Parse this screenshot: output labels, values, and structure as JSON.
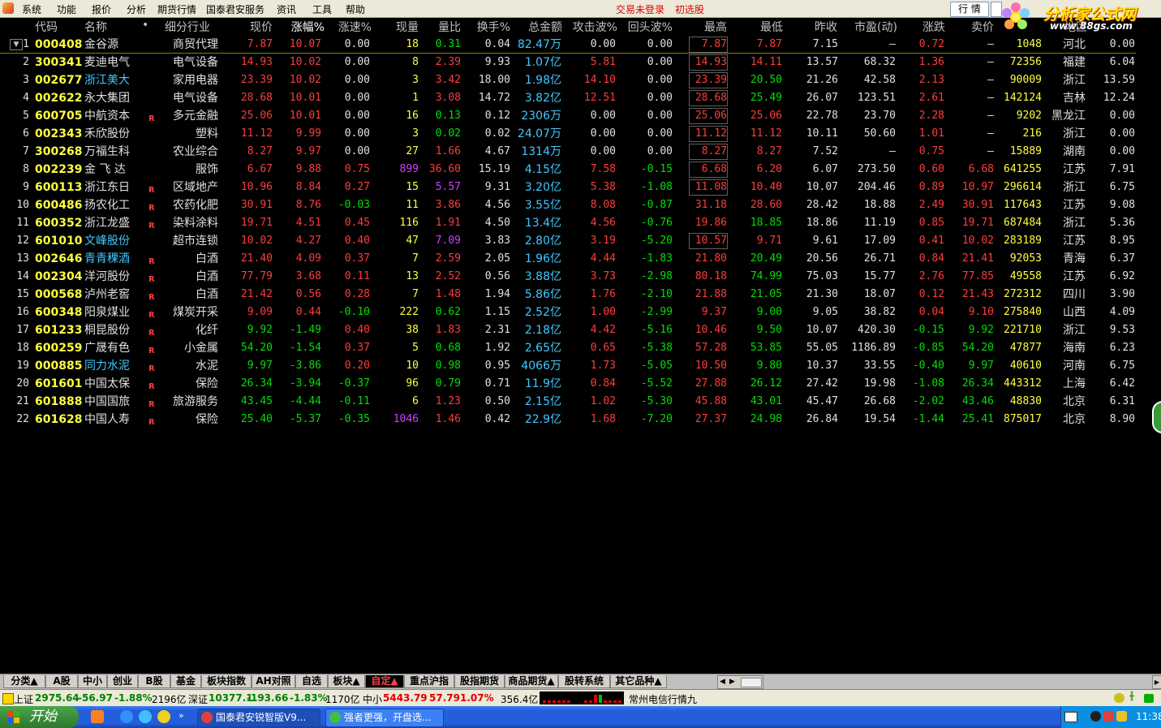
{
  "menu": {
    "items": [
      "系统",
      "功能",
      "报价",
      "分析",
      "期货行情",
      "国泰君安服务",
      "资讯",
      "工具",
      "帮助"
    ],
    "status_login": "交易未登录",
    "status_select": "初选股",
    "quote_button": "行 情"
  },
  "logo": {
    "text": "分析家公式网",
    "url_text": "www.88gs.com"
  },
  "colors": {
    "up": "#ff3c3c",
    "down": "#00e000",
    "flat": "#e0e0e0",
    "code": "#ffff40",
    "name": "#e0e0e0",
    "name_link": "#40c8ff",
    "amount": "#40c8ff",
    "accent_purple": "#d040ff",
    "vol": "#ffff40"
  },
  "headers": [
    "代码",
    "名称",
    "•",
    "细分行业",
    "现价",
    "涨幅%",
    "涨速%",
    "现量",
    "量比",
    "换手%",
    "总金额",
    "攻击波%",
    "回头波%",
    "最高",
    "最低",
    "昨收",
    "市盈(动)",
    "涨跌",
    "卖价",
    "",
    "地区",
    ""
  ],
  "rows": [
    {
      "i": "1",
      "code": "000408",
      "name": "金谷源",
      "r": "",
      "ind": "商贸代理",
      "price": "7.87",
      "chg": "10.07",
      "spd": "0.00",
      "vol": "18",
      "vr": "0.31",
      "turn": "0.04",
      "amt": "82.47万",
      "atk": "0.00",
      "back": "0.00",
      "hi": "7.87",
      "lo": "7.87",
      "prev": "7.15",
      "pe": "–",
      "diff": "0.72",
      "ask": "–",
      "v2": "1048",
      "reg": "河北",
      "last": "0.00",
      "cp": "u",
      "cs": "f",
      "ca": "f",
      "cb": "f",
      "chi": "u",
      "clo": "u",
      "cd": "u",
      "cask": "f",
      "link": false,
      "hibox": true
    },
    {
      "i": "2",
      "code": "300341",
      "name": "麦迪电气",
      "r": "",
      "ind": "电气设备",
      "price": "14.93",
      "chg": "10.02",
      "spd": "0.00",
      "vol": "8",
      "vr": "2.39",
      "turn": "9.93",
      "amt": "1.07亿",
      "atk": "5.81",
      "back": "0.00",
      "hi": "14.93",
      "lo": "14.11",
      "prev": "13.57",
      "pe": "68.32",
      "diff": "1.36",
      "ask": "–",
      "v2": "72356",
      "reg": "福建",
      "last": "6.04",
      "cp": "u",
      "cs": "f",
      "ca": "u",
      "cb": "f",
      "chi": "u",
      "clo": "u",
      "cd": "u",
      "cask": "f",
      "link": false,
      "hibox": true
    },
    {
      "i": "3",
      "code": "002677",
      "name": "浙江美大",
      "r": "",
      "ind": "家用电器",
      "price": "23.39",
      "chg": "10.02",
      "spd": "0.00",
      "vol": "3",
      "vr": "3.42",
      "turn": "18.00",
      "amt": "1.98亿",
      "atk": "14.10",
      "back": "0.00",
      "hi": "23.39",
      "lo": "20.50",
      "prev": "21.26",
      "pe": "42.58",
      "diff": "2.13",
      "ask": "–",
      "v2": "90009",
      "reg": "浙江",
      "last": "13.59",
      "cp": "u",
      "cs": "f",
      "ca": "u",
      "cb": "f",
      "chi": "u",
      "clo": "d",
      "cd": "u",
      "cask": "f",
      "link": true,
      "hibox": true
    },
    {
      "i": "4",
      "code": "002622",
      "name": "永大集团",
      "r": "",
      "ind": "电气设备",
      "price": "28.68",
      "chg": "10.01",
      "spd": "0.00",
      "vol": "1",
      "vr": "3.08",
      "turn": "14.72",
      "amt": "3.82亿",
      "atk": "12.51",
      "back": "0.00",
      "hi": "28.68",
      "lo": "25.49",
      "prev": "26.07",
      "pe": "123.51",
      "diff": "2.61",
      "ask": "–",
      "v2": "142124",
      "reg": "吉林",
      "last": "12.24",
      "cp": "u",
      "cs": "f",
      "ca": "u",
      "cb": "f",
      "chi": "u",
      "clo": "d",
      "cd": "u",
      "cask": "f",
      "link": false,
      "hibox": true
    },
    {
      "i": "5",
      "code": "600705",
      "name": "中航资本",
      "r": "R",
      "ind": "多元金融",
      "price": "25.06",
      "chg": "10.01",
      "spd": "0.00",
      "vol": "16",
      "vr": "0.13",
      "turn": "0.12",
      "amt": "2306万",
      "atk": "0.00",
      "back": "0.00",
      "hi": "25.06",
      "lo": "25.06",
      "prev": "22.78",
      "pe": "23.70",
      "diff": "2.28",
      "ask": "–",
      "v2": "9202",
      "reg": "黑龙江",
      "last": "0.00",
      "cp": "u",
      "cs": "f",
      "ca": "f",
      "cb": "f",
      "chi": "u",
      "clo": "u",
      "cd": "u",
      "cask": "f",
      "link": false,
      "hibox": true
    },
    {
      "i": "6",
      "code": "002343",
      "name": "禾欣股份",
      "r": "",
      "ind": "塑料",
      "price": "11.12",
      "chg": "9.99",
      "spd": "0.00",
      "vol": "3",
      "vr": "0.02",
      "turn": "0.02",
      "amt": "24.07万",
      "atk": "0.00",
      "back": "0.00",
      "hi": "11.12",
      "lo": "11.12",
      "prev": "10.11",
      "pe": "50.60",
      "diff": "1.01",
      "ask": "–",
      "v2": "216",
      "reg": "浙江",
      "last": "0.00",
      "cp": "u",
      "cs": "f",
      "ca": "f",
      "cb": "f",
      "chi": "u",
      "clo": "u",
      "cd": "u",
      "cask": "f",
      "link": false,
      "hibox": true
    },
    {
      "i": "7",
      "code": "300268",
      "name": "万福生科",
      "r": "",
      "ind": "农业综合",
      "price": "8.27",
      "chg": "9.97",
      "spd": "0.00",
      "vol": "27",
      "vr": "1.66",
      "turn": "4.67",
      "amt": "1314万",
      "atk": "0.00",
      "back": "0.00",
      "hi": "8.27",
      "lo": "8.27",
      "prev": "7.52",
      "pe": "–",
      "diff": "0.75",
      "ask": "–",
      "v2": "15889",
      "reg": "湖南",
      "last": "0.00",
      "cp": "u",
      "cs": "f",
      "ca": "f",
      "cb": "f",
      "chi": "u",
      "clo": "u",
      "cd": "u",
      "cask": "f",
      "link": false,
      "hibox": true
    },
    {
      "i": "8",
      "code": "002239",
      "name": "金 飞 达",
      "r": "",
      "ind": "服饰",
      "price": "6.67",
      "chg": "9.88",
      "spd": "0.75",
      "vol": "899",
      "vr": "36.60",
      "turn": "15.19",
      "amt": "4.15亿",
      "atk": "7.58",
      "back": "-0.15",
      "hi": "6.68",
      "lo": "6.20",
      "prev": "6.07",
      "pe": "273.50",
      "diff": "0.60",
      "ask": "6.68",
      "v2": "641255",
      "reg": "江苏",
      "last": "7.91",
      "cp": "u",
      "cs": "u",
      "ca": "u",
      "cb": "d",
      "chi": "u",
      "clo": "u",
      "cd": "u",
      "cask": "u",
      "link": false,
      "hibox": true,
      "volp": true
    },
    {
      "i": "9",
      "code": "600113",
      "name": "浙江东日",
      "r": "R",
      "ind": "区域地产",
      "price": "10.96",
      "chg": "8.84",
      "spd": "0.27",
      "vol": "15",
      "vr": "5.57",
      "turn": "9.31",
      "amt": "3.20亿",
      "atk": "5.38",
      "back": "-1.08",
      "hi": "11.08",
      "lo": "10.40",
      "prev": "10.07",
      "pe": "204.46",
      "diff": "0.89",
      "ask": "10.97",
      "v2": "296614",
      "reg": "浙江",
      "last": "6.75",
      "cp": "u",
      "cs": "u",
      "ca": "u",
      "cb": "d",
      "chi": "u",
      "clo": "u",
      "cd": "u",
      "cask": "u",
      "link": false,
      "hibox": true,
      "vrp": true
    },
    {
      "i": "10",
      "code": "600486",
      "name": "扬农化工",
      "r": "R",
      "ind": "农药化肥",
      "price": "30.91",
      "chg": "8.76",
      "spd": "-0.03",
      "vol": "11",
      "vr": "3.86",
      "turn": "4.56",
      "amt": "3.55亿",
      "atk": "8.08",
      "back": "-0.87",
      "hi": "31.18",
      "lo": "28.60",
      "prev": "28.42",
      "pe": "18.88",
      "diff": "2.49",
      "ask": "30.91",
      "v2": "117643",
      "reg": "江苏",
      "last": "9.08",
      "cp": "u",
      "cs": "d",
      "ca": "u",
      "cb": "d",
      "chi": "u",
      "clo": "u",
      "cd": "u",
      "cask": "u",
      "link": false,
      "hibox": false
    },
    {
      "i": "11",
      "code": "600352",
      "name": "浙江龙盛",
      "r": "R",
      "ind": "染料涂料",
      "price": "19.71",
      "chg": "4.51",
      "spd": "0.45",
      "vol": "116",
      "vr": "1.91",
      "turn": "4.50",
      "amt": "13.4亿",
      "atk": "4.56",
      "back": "-0.76",
      "hi": "19.86",
      "lo": "18.85",
      "prev": "18.86",
      "pe": "11.19",
      "diff": "0.85",
      "ask": "19.71",
      "v2": "687484",
      "reg": "浙江",
      "last": "5.36",
      "cp": "u",
      "cs": "u",
      "ca": "u",
      "cb": "d",
      "chi": "u",
      "clo": "d",
      "cd": "u",
      "cask": "u",
      "link": false,
      "hibox": false
    },
    {
      "i": "12",
      "code": "601010",
      "name": "文峰股份",
      "r": "",
      "ind": "超市连锁",
      "price": "10.02",
      "chg": "4.27",
      "spd": "0.40",
      "vol": "47",
      "vr": "7.09",
      "turn": "3.83",
      "amt": "2.80亿",
      "atk": "3.19",
      "back": "-5.20",
      "hi": "10.57",
      "lo": "9.71",
      "prev": "9.61",
      "pe": "17.09",
      "diff": "0.41",
      "ask": "10.02",
      "v2": "283189",
      "reg": "江苏",
      "last": "8.95",
      "cp": "u",
      "cs": "u",
      "ca": "u",
      "cb": "d",
      "chi": "u",
      "clo": "u",
      "cd": "u",
      "cask": "u",
      "link": true,
      "hibox": true,
      "vrp": true
    },
    {
      "i": "13",
      "code": "002646",
      "name": "青青稞酒",
      "r": "R",
      "ind": "白酒",
      "price": "21.40",
      "chg": "4.09",
      "spd": "0.37",
      "vol": "7",
      "vr": "2.59",
      "turn": "2.05",
      "amt": "1.96亿",
      "atk": "4.44",
      "back": "-1.83",
      "hi": "21.80",
      "lo": "20.49",
      "prev": "20.56",
      "pe": "26.71",
      "diff": "0.84",
      "ask": "21.41",
      "v2": "92053",
      "reg": "青海",
      "last": "6.37",
      "cp": "u",
      "cs": "u",
      "ca": "u",
      "cb": "d",
      "chi": "u",
      "clo": "d",
      "cd": "u",
      "cask": "u",
      "link": true,
      "hibox": false
    },
    {
      "i": "14",
      "code": "002304",
      "name": "洋河股份",
      "r": "R",
      "ind": "白酒",
      "price": "77.79",
      "chg": "3.68",
      "spd": "0.11",
      "vol": "13",
      "vr": "2.52",
      "turn": "0.56",
      "amt": "3.88亿",
      "atk": "3.73",
      "back": "-2.98",
      "hi": "80.18",
      "lo": "74.99",
      "prev": "75.03",
      "pe": "15.77",
      "diff": "2.76",
      "ask": "77.85",
      "v2": "49558",
      "reg": "江苏",
      "last": "6.92",
      "cp": "u",
      "cs": "u",
      "ca": "u",
      "cb": "d",
      "chi": "u",
      "clo": "d",
      "cd": "u",
      "cask": "u",
      "link": false,
      "hibox": false
    },
    {
      "i": "15",
      "code": "000568",
      "name": "泸州老窖",
      "r": "R",
      "ind": "白酒",
      "price": "21.42",
      "chg": "0.56",
      "spd": "0.28",
      "vol": "7",
      "vr": "1.48",
      "turn": "1.94",
      "amt": "5.86亿",
      "atk": "1.76",
      "back": "-2.10",
      "hi": "21.88",
      "lo": "21.05",
      "prev": "21.30",
      "pe": "18.07",
      "diff": "0.12",
      "ask": "21.43",
      "v2": "272312",
      "reg": "四川",
      "last": "3.90",
      "cp": "u",
      "cs": "u",
      "ca": "u",
      "cb": "d",
      "chi": "u",
      "clo": "d",
      "cd": "u",
      "cask": "u",
      "link": false,
      "hibox": false
    },
    {
      "i": "16",
      "code": "600348",
      "name": "阳泉煤业",
      "r": "R",
      "ind": "煤炭开采",
      "price": "9.09",
      "chg": "0.44",
      "spd": "-0.10",
      "vol": "222",
      "vr": "0.62",
      "turn": "1.15",
      "amt": "2.52亿",
      "atk": "1.00",
      "back": "-2.99",
      "hi": "9.37",
      "lo": "9.00",
      "prev": "9.05",
      "pe": "38.82",
      "diff": "0.04",
      "ask": "9.10",
      "v2": "275840",
      "reg": "山西",
      "last": "4.09",
      "cp": "u",
      "cs": "d",
      "ca": "u",
      "cb": "d",
      "chi": "u",
      "clo": "d",
      "cd": "u",
      "cask": "u",
      "link": false,
      "hibox": false
    },
    {
      "i": "17",
      "code": "601233",
      "name": "桐昆股份",
      "r": "R",
      "ind": "化纤",
      "price": "9.92",
      "chg": "-1.49",
      "spd": "0.40",
      "vol": "38",
      "vr": "1.83",
      "turn": "2.31",
      "amt": "2.18亿",
      "atk": "4.42",
      "back": "-5.16",
      "hi": "10.46",
      "lo": "9.50",
      "prev": "10.07",
      "pe": "420.30",
      "diff": "-0.15",
      "ask": "9.92",
      "v2": "221710",
      "reg": "浙江",
      "last": "9.53",
      "cp": "d",
      "cs": "u",
      "ca": "u",
      "cb": "d",
      "chi": "u",
      "clo": "d",
      "cd": "d",
      "cask": "d",
      "link": false,
      "hibox": false
    },
    {
      "i": "18",
      "code": "600259",
      "name": "广晟有色",
      "r": "R",
      "ind": "小金属",
      "price": "54.20",
      "chg": "-1.54",
      "spd": "0.37",
      "vol": "5",
      "vr": "0.68",
      "turn": "1.92",
      "amt": "2.65亿",
      "atk": "0.65",
      "back": "-5.38",
      "hi": "57.28",
      "lo": "53.85",
      "prev": "55.05",
      "pe": "1186.89",
      "diff": "-0.85",
      "ask": "54.20",
      "v2": "47877",
      "reg": "海南",
      "last": "6.23",
      "cp": "d",
      "cs": "u",
      "ca": "u",
      "cb": "d",
      "chi": "u",
      "clo": "d",
      "cd": "d",
      "cask": "d",
      "link": false,
      "hibox": false
    },
    {
      "i": "19",
      "code": "000885",
      "name": "同力水泥",
      "r": "R",
      "ind": "水泥",
      "price": "9.97",
      "chg": "-3.86",
      "spd": "0.20",
      "vol": "10",
      "vr": "0.98",
      "turn": "0.95",
      "amt": "4066万",
      "atk": "1.73",
      "back": "-5.05",
      "hi": "10.50",
      "lo": "9.80",
      "prev": "10.37",
      "pe": "33.55",
      "diff": "-0.40",
      "ask": "9.97",
      "v2": "40610",
      "reg": "河南",
      "last": "6.75",
      "cp": "d",
      "cs": "u",
      "ca": "u",
      "cb": "d",
      "chi": "u",
      "clo": "d",
      "cd": "d",
      "cask": "d",
      "link": true,
      "hibox": false
    },
    {
      "i": "20",
      "code": "601601",
      "name": "中国太保",
      "r": "R",
      "ind": "保险",
      "price": "26.34",
      "chg": "-3.94",
      "spd": "-0.37",
      "vol": "96",
      "vr": "0.79",
      "turn": "0.71",
      "amt": "11.9亿",
      "atk": "0.84",
      "back": "-5.52",
      "hi": "27.88",
      "lo": "26.12",
      "prev": "27.42",
      "pe": "19.98",
      "diff": "-1.08",
      "ask": "26.34",
      "v2": "443312",
      "reg": "上海",
      "last": "6.42",
      "cp": "d",
      "cs": "d",
      "ca": "u",
      "cb": "d",
      "chi": "u",
      "clo": "d",
      "cd": "d",
      "cask": "d",
      "link": false,
      "hibox": false
    },
    {
      "i": "21",
      "code": "601888",
      "name": "中国国旅",
      "r": "R",
      "ind": "旅游服务",
      "price": "43.45",
      "chg": "-4.44",
      "spd": "-0.11",
      "vol": "6",
      "vr": "1.23",
      "turn": "0.50",
      "amt": "2.15亿",
      "atk": "1.02",
      "back": "-5.30",
      "hi": "45.88",
      "lo": "43.01",
      "prev": "45.47",
      "pe": "26.68",
      "diff": "-2.02",
      "ask": "43.46",
      "v2": "48830",
      "reg": "北京",
      "last": "6.31",
      "cp": "d",
      "cs": "d",
      "ca": "u",
      "cb": "d",
      "chi": "u",
      "clo": "d",
      "cd": "d",
      "cask": "d",
      "link": false,
      "hibox": false
    },
    {
      "i": "22",
      "code": "601628",
      "name": "中国人寿",
      "r": "R",
      "ind": "保险",
      "price": "25.40",
      "chg": "-5.37",
      "spd": "-0.35",
      "vol": "1046",
      "vr": "1.46",
      "turn": "0.42",
      "amt": "22.9亿",
      "atk": "1.68",
      "back": "-7.20",
      "hi": "27.37",
      "lo": "24.98",
      "prev": "26.84",
      "pe": "19.54",
      "diff": "-1.44",
      "ask": "25.41",
      "v2": "875017",
      "reg": "北京",
      "last": "8.90",
      "cp": "d",
      "cs": "d",
      "ca": "u",
      "cb": "d",
      "chi": "u",
      "clo": "d",
      "cd": "d",
      "cask": "d",
      "link": false,
      "hibox": false,
      "volp": true
    }
  ],
  "tabs": [
    "分类▲",
    "A股",
    "中小",
    "创业",
    "B股",
    "基金",
    "板块指数",
    "AH对照",
    "自选",
    "板块▲",
    "自定▲",
    "重点沪指",
    "股指期货",
    "商品期货▲",
    "股转系统",
    "其它品种▲"
  ],
  "active_tab": "自定▲",
  "status": {
    "sh_label": "上证",
    "sh_val": "2975.64",
    "sh_chg": "-56.97",
    "sh_pct": "-1.88%",
    "sh_amt": "2196亿",
    "sz_label": "深证",
    "sz_val": "10377.1",
    "sz_chg": "-193.66",
    "sz_pct": "-1.83%",
    "sz_amt": "1170亿",
    "zx_label": "中小",
    "zx_val": "5443.79",
    "zx_chg": "57.79",
    "zx_pct": "1.07%",
    "zx_amt": "356.4亿",
    "server": "常州电信行情九"
  },
  "taskbar": {
    "start": "开始",
    "tasks": [
      "国泰君安锐智版V9...",
      "强者更强，开盘选..."
    ],
    "time": "11:38"
  }
}
